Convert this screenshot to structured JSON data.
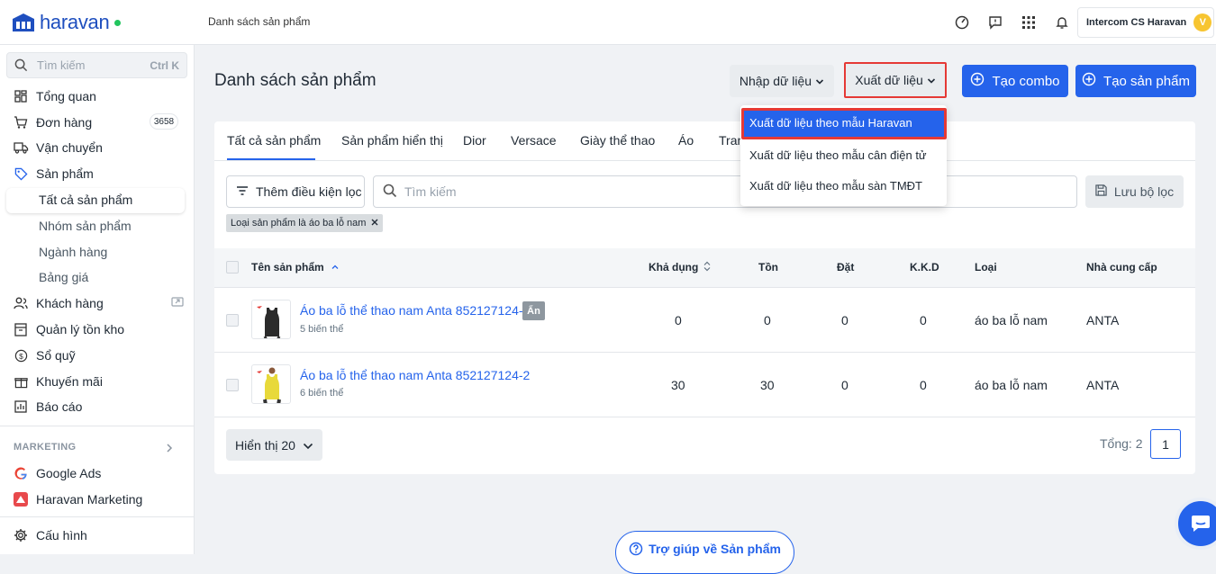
{
  "brand": {
    "name": "haravan"
  },
  "header": {
    "breadcrumb": "Danh sách sản phẩm",
    "account_name": "Intercom CS Haravan",
    "avatar_initial": "V"
  },
  "sidebar": {
    "search": {
      "placeholder": "Tìm kiếm",
      "shortcut": "Ctrl K"
    },
    "items": [
      {
        "label": "Tổng quan",
        "icon": "dashboard-icon"
      },
      {
        "label": "Đơn hàng",
        "icon": "cart-icon",
        "badge": "3658"
      },
      {
        "label": "Vận chuyển",
        "icon": "truck-icon"
      },
      {
        "label": "Sản phẩm",
        "icon": "tag-icon"
      },
      {
        "label": "Khách hàng",
        "icon": "users-icon"
      },
      {
        "label": "Quản lý tồn kho",
        "icon": "inventory-icon"
      },
      {
        "label": "Sổ quỹ",
        "icon": "dollar-icon"
      },
      {
        "label": "Khuyến mãi",
        "icon": "gift-icon"
      },
      {
        "label": "Báo cáo",
        "icon": "report-icon"
      }
    ],
    "sub_items": [
      "Tất cả sản phẩm",
      "Nhóm sản phẩm",
      "Ngành hàng",
      "Bảng giá"
    ],
    "marketing_label": "MARKETING",
    "marketing_items": [
      {
        "label": "Google Ads",
        "icon": "google-icon"
      },
      {
        "label": "Haravan Marketing",
        "icon": "haravan-marketing-icon"
      }
    ],
    "settings_label": "Cấu hình"
  },
  "page": {
    "title": "Danh sách sản phẩm",
    "import_label": "Nhập dữ liệu",
    "export_label": "Xuất dữ liệu",
    "combo_label": "Tạo combo",
    "create_label": "Tạo sản phẩm"
  },
  "export_menu": [
    "Xuất dữ liệu theo mẫu Haravan",
    "Xuất dữ liệu theo mẫu cân điện tử",
    "Xuất dữ liệu theo mẫu sàn TMĐT"
  ],
  "tabs": [
    "Tất cả sản phẩm",
    "Sản phẩm hiển thị",
    "Dior",
    "Versace",
    "Giày thể thao",
    "Áo",
    "Tran"
  ],
  "filter": {
    "add_label": "Thêm điều kiện lọc",
    "search_placeholder": "Tìm kiếm",
    "save_label": "Lưu bộ lọc",
    "chip": "Loại sản phẩm là áo ba lỗ nam"
  },
  "table": {
    "headers": [
      "Tên sản phẩm",
      "Khả dụng",
      "Tồn",
      "Đặt",
      "K.K.D",
      "Loại",
      "Nhà cung cấp"
    ],
    "rows": [
      {
        "name": "Áo ba lỗ thể thao nam Anta 852127124-1",
        "variants": "5 biến thể",
        "hidden_badge": "Ẩn",
        "available": "0",
        "stock": "0",
        "ordered": "0",
        "kkd": "0",
        "type": "áo ba lỗ nam",
        "vendor": "ANTA",
        "shirt_color": "#2b2b2b"
      },
      {
        "name": "Áo ba lỗ thể thao nam Anta 852127124-2",
        "variants": "6 biến thể",
        "available": "30",
        "stock": "30",
        "ordered": "0",
        "kkd": "0",
        "type": "áo ba lỗ nam",
        "vendor": "ANTA",
        "shirt_color": "#e8d93a"
      }
    ]
  },
  "footer": {
    "per_page": "Hiển thị 20",
    "total": "Tổng: 2",
    "page": "1",
    "help": "Trợ giúp về Sản phẩm"
  },
  "colors": {
    "primary": "#2563eb",
    "highlight": "#e53935"
  }
}
